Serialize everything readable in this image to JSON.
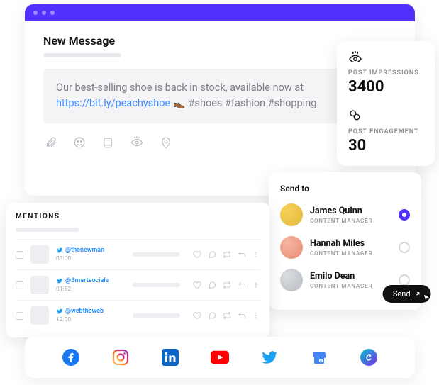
{
  "composer": {
    "title": "New Message",
    "text": "Our best-selling shoe is back in stock, available now at ",
    "link": "https://bit.ly/peachyshoe",
    "emoji": "👞",
    "hashtags": " #shoes #fashion #shopping"
  },
  "stats": {
    "impressions_label": "POST IMPRESSIONS",
    "impressions_value": "3400",
    "engagement_label": "POST ENGAGEMENT",
    "engagement_value": "30"
  },
  "sendto": {
    "heading": "Send to",
    "people": [
      {
        "name": "James Quinn",
        "role": "CONTENT MANAGER",
        "selected": true
      },
      {
        "name": "Hannah Miles",
        "role": "CONTENT MANAGER",
        "selected": false
      },
      {
        "name": "Emilo Dean",
        "role": "CONTENT MANAGER",
        "selected": false
      }
    ],
    "send_label": "Send"
  },
  "mentions": {
    "heading": "MENTIONS",
    "items": [
      {
        "handle": "@thenewman",
        "time": "03:00"
      },
      {
        "handle": "@Smartsocials",
        "time": "01:52"
      },
      {
        "handle": "@webtheweb",
        "time": "12:00"
      }
    ]
  }
}
